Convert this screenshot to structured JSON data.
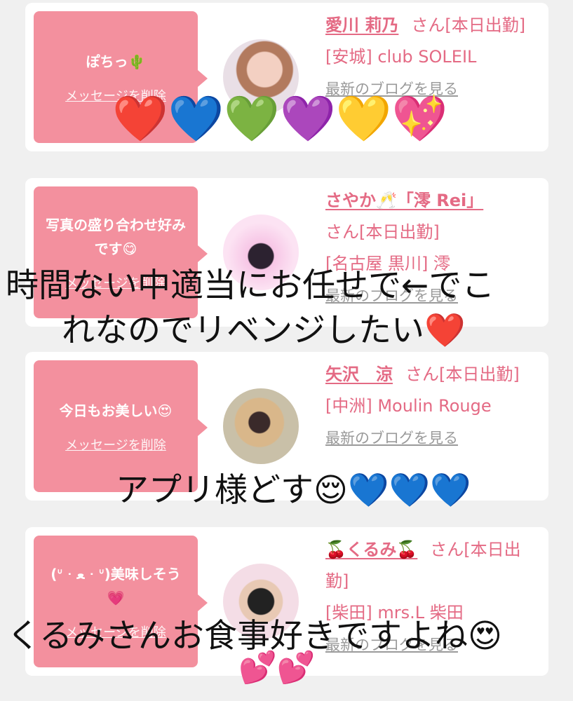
{
  "cards": [
    {
      "message": "ぽちっ🌵",
      "delete_label": "メッセージを削除",
      "name": "愛川 莉乃",
      "san": "さん[本日出勤]",
      "store": "[安城] club SOLEIL",
      "blog": "最新のブログを見る"
    },
    {
      "message": "写真の盛り合わせ好みです😋",
      "delete_label": "メッセージを削除",
      "name": "さやか🥂「澪 Rei」",
      "san": "さん[本日出勤]",
      "store": "[名古屋 黒川] 澪",
      "blog": "最新のブログを見る"
    },
    {
      "message": "今日もお美しい😍",
      "delete_label": "メッセージを削除",
      "name": "矢沢　涼",
      "san": "さん[本日出勤]",
      "store": "[中洲] Moulin Rouge",
      "blog": "最新のブログを見る"
    },
    {
      "message": "(ᐡ ᐧ ﻌ ᐧ ᐡ)美味しそう💗",
      "delete_label": "メッセージを削除",
      "name": "🍒くるみ🍒",
      "san": "さん[本日出勤]",
      "store": "[柴田] mrs.L 柴田",
      "blog": "最新のブログを見る"
    }
  ],
  "overlays": {
    "hearts_row": "❤️💙💚💜💛💖",
    "line_time": "時間ない中適当にお任せで←でこ",
    "line_revenge": "れなのでリベンジしたい❤️",
    "line_app": "アプリ様どす😌💙💙💙",
    "line_kurumi": "くるみさんお食事好きですよね😍",
    "line_small_hearts": "💕💕"
  }
}
